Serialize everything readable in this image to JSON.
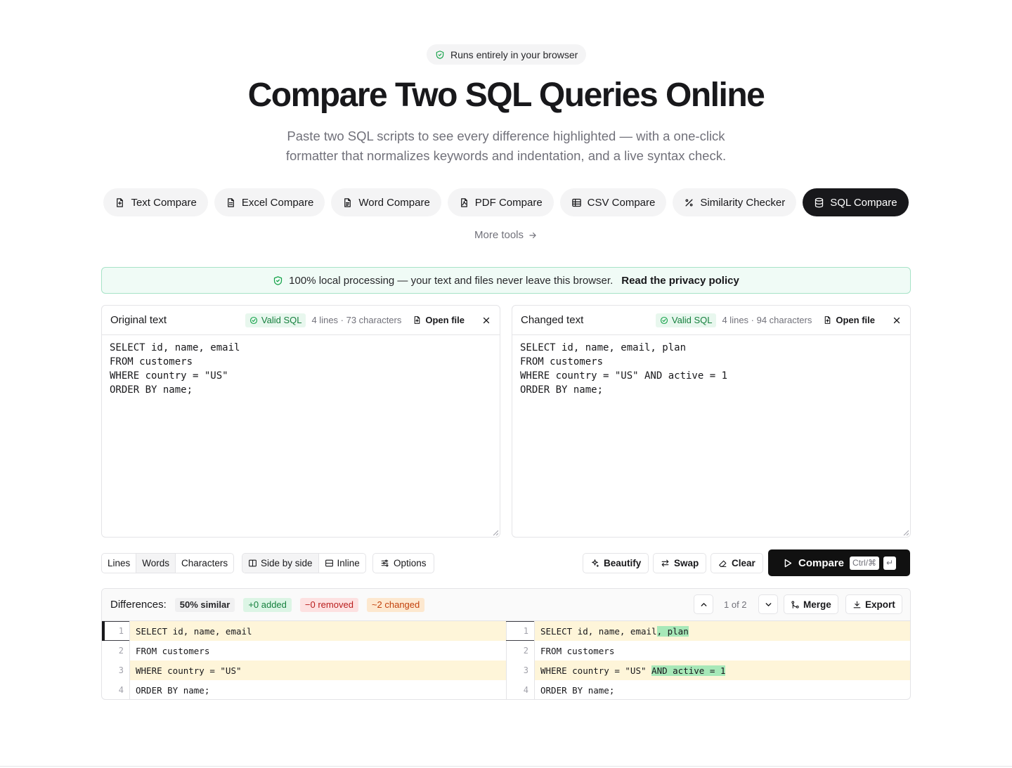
{
  "hero": {
    "badge": "Runs entirely in your browser",
    "title": "Compare Two SQL Queries Online",
    "subtitle": "Paste two SQL scripts to see every difference highlighted — with a one-click formatter that normalizes keywords and indentation, and a live syntax check."
  },
  "tools": [
    {
      "label": "Text Compare",
      "icon": "file-text-icon"
    },
    {
      "label": "Excel Compare",
      "icon": "file-spreadsheet-icon"
    },
    {
      "label": "Word Compare",
      "icon": "file-word-icon"
    },
    {
      "label": "PDF Compare",
      "icon": "file-pdf-icon"
    },
    {
      "label": "CSV Compare",
      "icon": "table-icon"
    },
    {
      "label": "Similarity Checker",
      "icon": "percent-icon"
    },
    {
      "label": "SQL Compare",
      "icon": "database-icon",
      "active": true
    }
  ],
  "more_tools": "More tools",
  "privacy": {
    "text": "100% local processing — your text and files never leave this browser.",
    "link": "Read the privacy policy"
  },
  "original": {
    "title": "Original text",
    "status": "Valid SQL",
    "counts": "4 lines · 73 characters",
    "open_file": "Open file",
    "content": "SELECT id, name, email\nFROM customers\nWHERE country = \"US\"\nORDER BY name;"
  },
  "changed": {
    "title": "Changed text",
    "status": "Valid SQL",
    "counts": "4 lines · 94 characters",
    "open_file": "Open file",
    "content": "SELECT id, name, email, plan\nFROM customers\nWHERE country = \"US\" AND active = 1\nORDER BY name;"
  },
  "toolbar": {
    "granularity": [
      "Lines",
      "Words",
      "Characters"
    ],
    "granularity_selected": "Words",
    "view": [
      "Side by side",
      "Inline"
    ],
    "view_selected": "Side by side",
    "options": "Options",
    "beautify": "Beautify",
    "swap": "Swap",
    "clear": "Clear",
    "compare": "Compare",
    "shortcut_mod": "Ctrl/⌘",
    "shortcut_key": "↵"
  },
  "results": {
    "label": "Differences:",
    "similar": "50% similar",
    "added": "+0 added",
    "removed": "−0 removed",
    "changed": "~2 changed",
    "position": "1 of 2",
    "merge": "Merge",
    "export": "Export"
  },
  "diff_rows": [
    {
      "ln": "1",
      "left": "SELECT id, name, email",
      "right_base": "SELECT id, name, email",
      "right_ins": ", plan",
      "changed": true,
      "current": true
    },
    {
      "ln": "2",
      "left": "FROM customers",
      "right_base": "FROM customers",
      "right_ins": "",
      "changed": false,
      "current": false
    },
    {
      "ln": "3",
      "left": "WHERE country = \"US\"",
      "right_base": "WHERE country = \"US\" ",
      "right_ins": "AND active = 1",
      "changed": true,
      "current": false
    },
    {
      "ln": "4",
      "left": "ORDER BY name;",
      "right_base": "ORDER BY name;",
      "right_ins": "",
      "changed": false,
      "current": false
    }
  ],
  "colors": {
    "accent_dark": "#111111",
    "valid_green": "#15803d",
    "changed_line_bg": "#fef5d9",
    "inserted_text_bg": "#a7e8b8"
  }
}
